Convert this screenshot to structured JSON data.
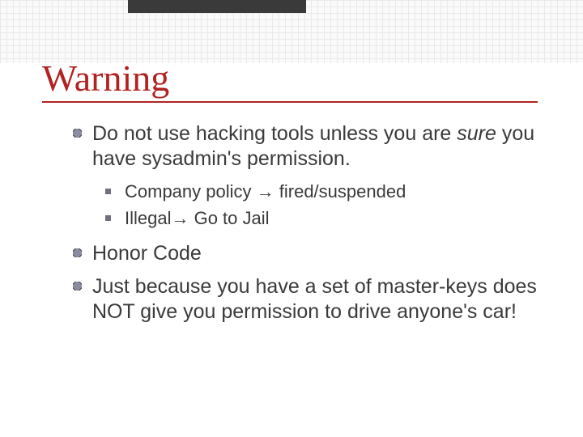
{
  "title": "Warning",
  "bullets": {
    "b1": {
      "pre": "Do not use hacking tools unless you are ",
      "emph": "sure",
      "post": " you have sysadmin's permission."
    },
    "sub": {
      "s1": {
        "pre": "Company policy ",
        "arrow": "→",
        "post": " fired/suspended"
      },
      "s2": {
        "pre": "Illegal",
        "arrow": "→",
        "post": " Go to Jail"
      }
    },
    "b2": "Honor Code",
    "b3": "Just because you have a set of master-keys does NOT give you permission to drive anyone's car!"
  }
}
